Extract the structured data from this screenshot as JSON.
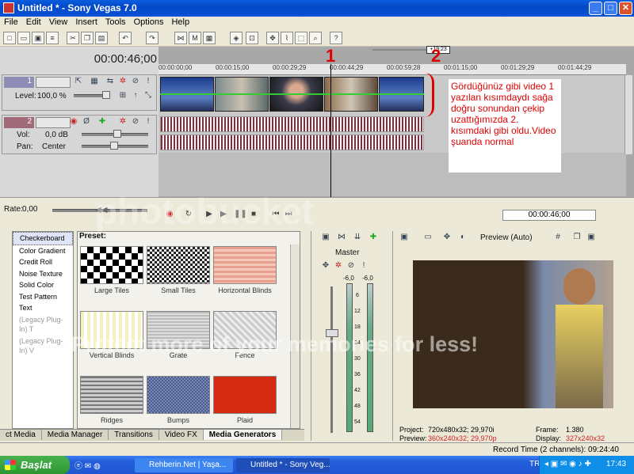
{
  "window": {
    "title": "Untitled * - Sony Vegas 7.0"
  },
  "menu": [
    "File",
    "Edit",
    "View",
    "Insert",
    "Tools",
    "Options",
    "Help"
  ],
  "timecode": "00:00:46;00",
  "ruler": [
    "00:00:00;00",
    "00:00:15;00",
    "00:00:29;29",
    "00:00:44;29",
    "00:00:59;28",
    "00:01:15;00",
    "00:01:29;29",
    "00:01:44;29"
  ],
  "marker_label": "+19:23",
  "annotation_numbers": [
    "1",
    "2"
  ],
  "tracks": {
    "video": {
      "number": "1",
      "level_label": "Level:",
      "level_value": "100,0 %"
    },
    "audio": {
      "number": "2",
      "vol_label": "Vol:",
      "vol_value": "0,0 dB",
      "pan_label": "Pan:",
      "pan_value": "Center"
    }
  },
  "note": "Gördüğünüz gibi video 1 yazılan kısımdaydı sağa doğru sonundan çekip uzattığımızda 2. kısımdaki gibi oldu.Video şuanda normal",
  "rate": {
    "label": "Rate:",
    "value": "0,00"
  },
  "transport_timecode": "00:00:46;00",
  "generators": [
    "Checkerboard",
    "Color Gradient",
    "Credit Roll",
    "Noise Texture",
    "Solid Color",
    "Test Pattern",
    "Text",
    "(Legacy Plug-In) T",
    "(Legacy Plug-In) V"
  ],
  "preset_label": "Preset:",
  "presets": [
    "Large Tiles",
    "Small Tiles",
    "Horizontal Blinds",
    "Vertical Blinds",
    "Grate",
    "Fence",
    "Ridges",
    "Bumps",
    "Plaid"
  ],
  "tabs": [
    "ct Media",
    "Media Manager",
    "Transitions",
    "Video FX",
    "Media Generators"
  ],
  "mixer": {
    "label": "Master",
    "scale": [
      "6",
      "12",
      "18",
      "24",
      "30",
      "36",
      "42",
      "48",
      "54"
    ],
    "peak_l": "-6,0",
    "peak_r": "-6,0"
  },
  "preview": {
    "mode": "Preview (Auto)",
    "project_label": "Project:",
    "project": "720x480x32; 29,970i",
    "preview_label": "Preview:",
    "preview_value": "360x240x32; 29,970p",
    "frame_label": "Frame:",
    "frame": "1.380",
    "display_label": "Display:",
    "display": "327x240x32"
  },
  "status": "Record Time (2 channels): 09:24:40",
  "taskbar": {
    "start": "Başlat",
    "tasks": [
      "Rehberin.Net | Yaşa...",
      "Untitled * - Sony Veg..."
    ],
    "lang": "TR",
    "clock": "17:43"
  },
  "watermarks": [
    "photobucket",
    "Protect more of your memories for less!"
  ],
  "colors": {
    "title_blue": "#0348c5",
    "note_red": "#dd0000",
    "taskbar": "#245edb"
  }
}
